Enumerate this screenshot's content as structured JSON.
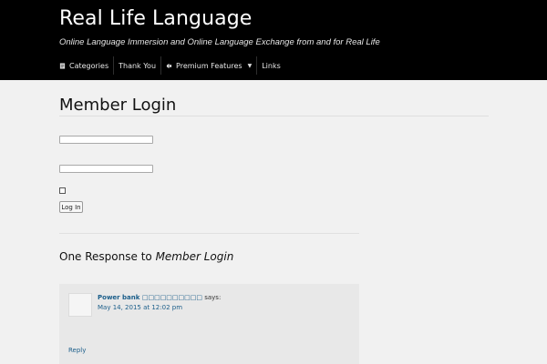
{
  "site": {
    "title": "Real Life Language",
    "description": "Online Language Immersion and Online Language Exchange from and for Real Life"
  },
  "nav": {
    "items": [
      {
        "label": "Categories",
        "icon": "document-icon"
      },
      {
        "label": "Thank You",
        "icon": ""
      },
      {
        "label": "Premium Features",
        "icon": "megaphone-icon",
        "caret": "▼"
      },
      {
        "label": "Links",
        "icon": ""
      }
    ]
  },
  "page": {
    "title": "Member Login"
  },
  "login_form": {
    "username_value": "",
    "password_value": "",
    "submit_label": "Log In"
  },
  "responses": {
    "heading_prefix": "One Response to ",
    "heading_title": "Member Login"
  },
  "comment": {
    "author": "Power bank □□□□□□□□□□",
    "says": " says:",
    "date": "May 14, 2015 at 12:02 pm",
    "reply_label": "Reply"
  },
  "colors": {
    "header_bg": "#000000",
    "link": "#1b5e8a",
    "page_bg": "#f1f1f1"
  }
}
